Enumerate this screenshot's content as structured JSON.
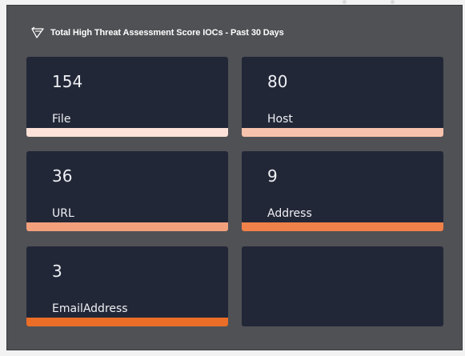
{
  "panel": {
    "title": "Total High Threat Assessment Score IOCs - Past 30 Days",
    "icon": "flag-triangle-icon"
  },
  "tiles": [
    {
      "value": "154",
      "label": "File",
      "bar_color": "#fde2d9"
    },
    {
      "value": "80",
      "label": "Host",
      "bar_color": "#f8c3ad"
    },
    {
      "value": "36",
      "label": "URL",
      "bar_color": "#f3a07d"
    },
    {
      "value": "9",
      "label": "Address",
      "bar_color": "#ef8149"
    },
    {
      "value": "3",
      "label": "EmailAddress",
      "bar_color": "#eb6e28"
    },
    {
      "value": "",
      "label": "",
      "bar_color": ""
    }
  ],
  "colors": {
    "panel_bg": "#505155",
    "tile_bg": "#222737",
    "text": "#eef0f4"
  }
}
